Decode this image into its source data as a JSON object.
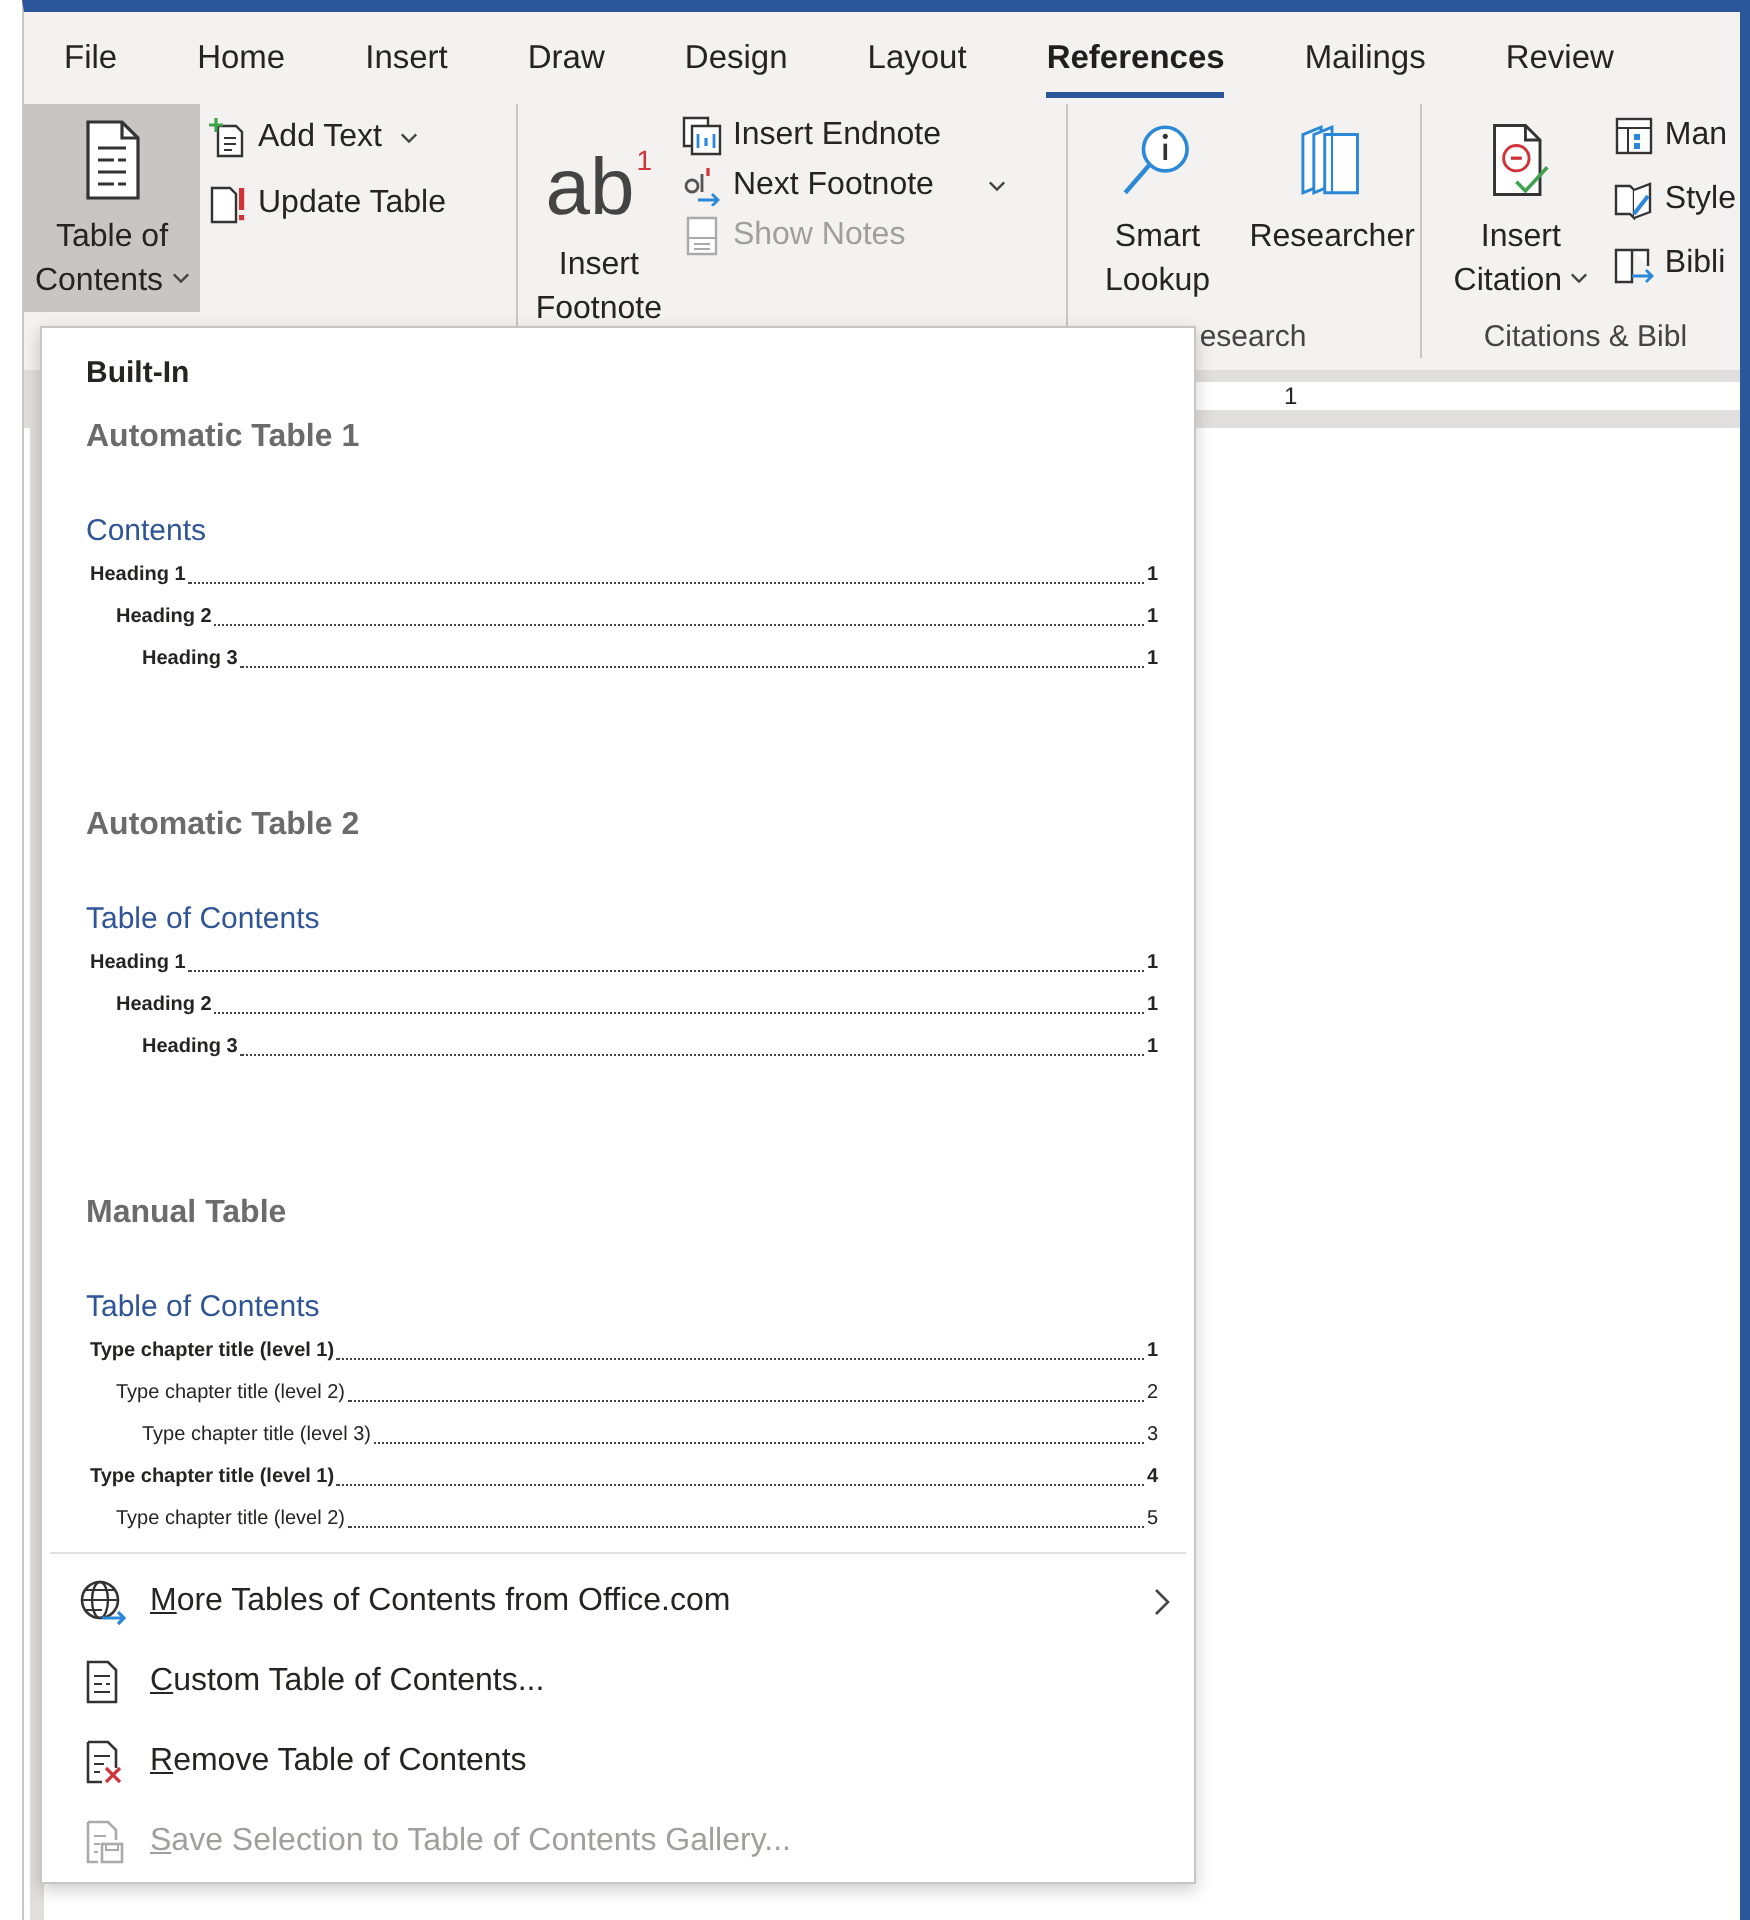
{
  "tabs": [
    {
      "label": "File",
      "selected": false
    },
    {
      "label": "Home",
      "selected": false
    },
    {
      "label": "Insert",
      "selected": false
    },
    {
      "label": "Draw",
      "selected": false
    },
    {
      "label": "Design",
      "selected": false
    },
    {
      "label": "Layout",
      "selected": false
    },
    {
      "label": "References",
      "selected": true
    },
    {
      "label": "Mailings",
      "selected": false
    },
    {
      "label": "Review",
      "selected": false
    }
  ],
  "ribbon_groups": [
    {
      "buttons": [
        {
          "kind": "large",
          "label": "Table of Contents",
          "dropdown": true,
          "expanded": true,
          "disabled": false
        },
        {
          "kind": "small",
          "label": "Add Text",
          "dropdown": true,
          "expanded": false,
          "disabled": false
        },
        {
          "kind": "small",
          "label": "Update Table",
          "dropdown": false,
          "expanded": false,
          "disabled": false
        }
      ]
    },
    {
      "buttons": [
        {
          "kind": "large",
          "label": "Insert Footnote",
          "glyph": "ab",
          "superscript": "1",
          "dropdown": false,
          "expanded": false,
          "disabled": false
        },
        {
          "kind": "small",
          "label": "Insert Endnote",
          "dropdown": false,
          "expanded": false,
          "disabled": false
        },
        {
          "kind": "small",
          "label": "Next Footnote",
          "dropdown": true,
          "expanded": false,
          "disabled": false
        },
        {
          "kind": "small",
          "label": "Show Notes",
          "dropdown": false,
          "expanded": false,
          "disabled": true
        }
      ]
    },
    {
      "label": "esearch",
      "buttons": [
        {
          "kind": "large",
          "label": "Smart Lookup",
          "dropdown": false,
          "expanded": false,
          "disabled": false
        },
        {
          "kind": "large",
          "label": "Researcher",
          "dropdown": false,
          "expanded": false,
          "disabled": false
        }
      ]
    },
    {
      "label": "Citations & Bibl",
      "buttons": [
        {
          "kind": "large",
          "label": "Insert Citation",
          "dropdown": true,
          "expanded": false,
          "disabled": false
        },
        {
          "kind": "small",
          "label": "Man",
          "dropdown": false,
          "expanded": false,
          "disabled": false
        },
        {
          "kind": "small",
          "label": "Style",
          "dropdown": false,
          "expanded": false,
          "disabled": false
        },
        {
          "kind": "small",
          "label": "Bibli",
          "dropdown": false,
          "expanded": false,
          "disabled": false
        }
      ]
    }
  ],
  "ruler": {
    "label": "1"
  },
  "toc_menu": {
    "header": "Built-In",
    "galleries": [
      {
        "kind": "automatic",
        "title": "Automatic Table 1",
        "preview_title": "Contents",
        "entries": [
          {
            "text": "Heading 1",
            "page": "1",
            "children": [
              {
                "text": "Heading 2",
                "page": "1",
                "children": [
                  {
                    "text": "Heading 3",
                    "page": "1"
                  }
                ]
              }
            ]
          }
        ]
      },
      {
        "kind": "automatic",
        "title": "Automatic Table 2",
        "preview_title": "Table of Contents",
        "entries": [
          {
            "text": "Heading 1",
            "page": "1",
            "children": [
              {
                "text": "Heading 2",
                "page": "1",
                "children": [
                  {
                    "text": "Heading 3",
                    "page": "1"
                  }
                ]
              }
            ]
          }
        ]
      },
      {
        "kind": "manual",
        "title": "Manual Table",
        "preview_title": "Table of Contents",
        "entries": [
          {
            "text": "Type chapter title (level 1)",
            "page": "1",
            "children": [
              {
                "text": "Type chapter title (level 2)",
                "page": "2",
                "children": [
                  {
                    "text": "Type chapter title (level 3)",
                    "page": "3"
                  }
                ]
              }
            ]
          },
          {
            "text": "Type chapter title (level 1)",
            "page": "4",
            "children": [
              {
                "text": "Type chapter title (level 2)",
                "page": "5"
              }
            ]
          }
        ]
      }
    ],
    "commands": [
      {
        "label": "More Tables of Contents from Office.com",
        "submenu": true,
        "disabled": false
      },
      {
        "label": "Custom Table of Contents...",
        "submenu": false,
        "disabled": false
      },
      {
        "label": "Remove Table of Contents",
        "submenu": false,
        "disabled": false
      },
      {
        "label": "Save Selection to Table of Contents Gallery...",
        "submenu": false,
        "disabled": true
      }
    ]
  }
}
